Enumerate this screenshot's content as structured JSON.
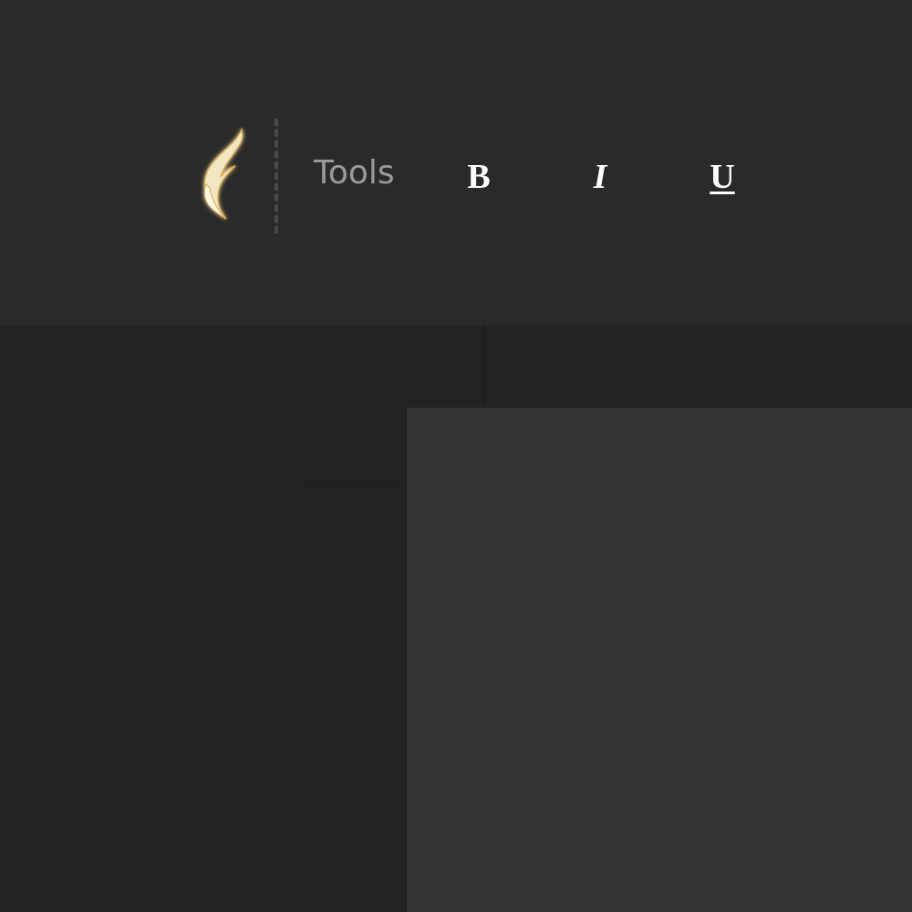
{
  "toolbar": {
    "logo": {
      "icon": "flame-logo-icon",
      "color": "#f3e6c2",
      "glow": "#c9a04a"
    },
    "tools_label": "Tools",
    "bold_label": "B",
    "italic_label": "I",
    "underline_label": "U"
  },
  "colors": {
    "toolbar_bg": "#2a2a2a",
    "workspace_bg": "#222222",
    "page_bg": "#333333",
    "tools_text": "#9a9a9a",
    "button_text": "#ffffff"
  }
}
